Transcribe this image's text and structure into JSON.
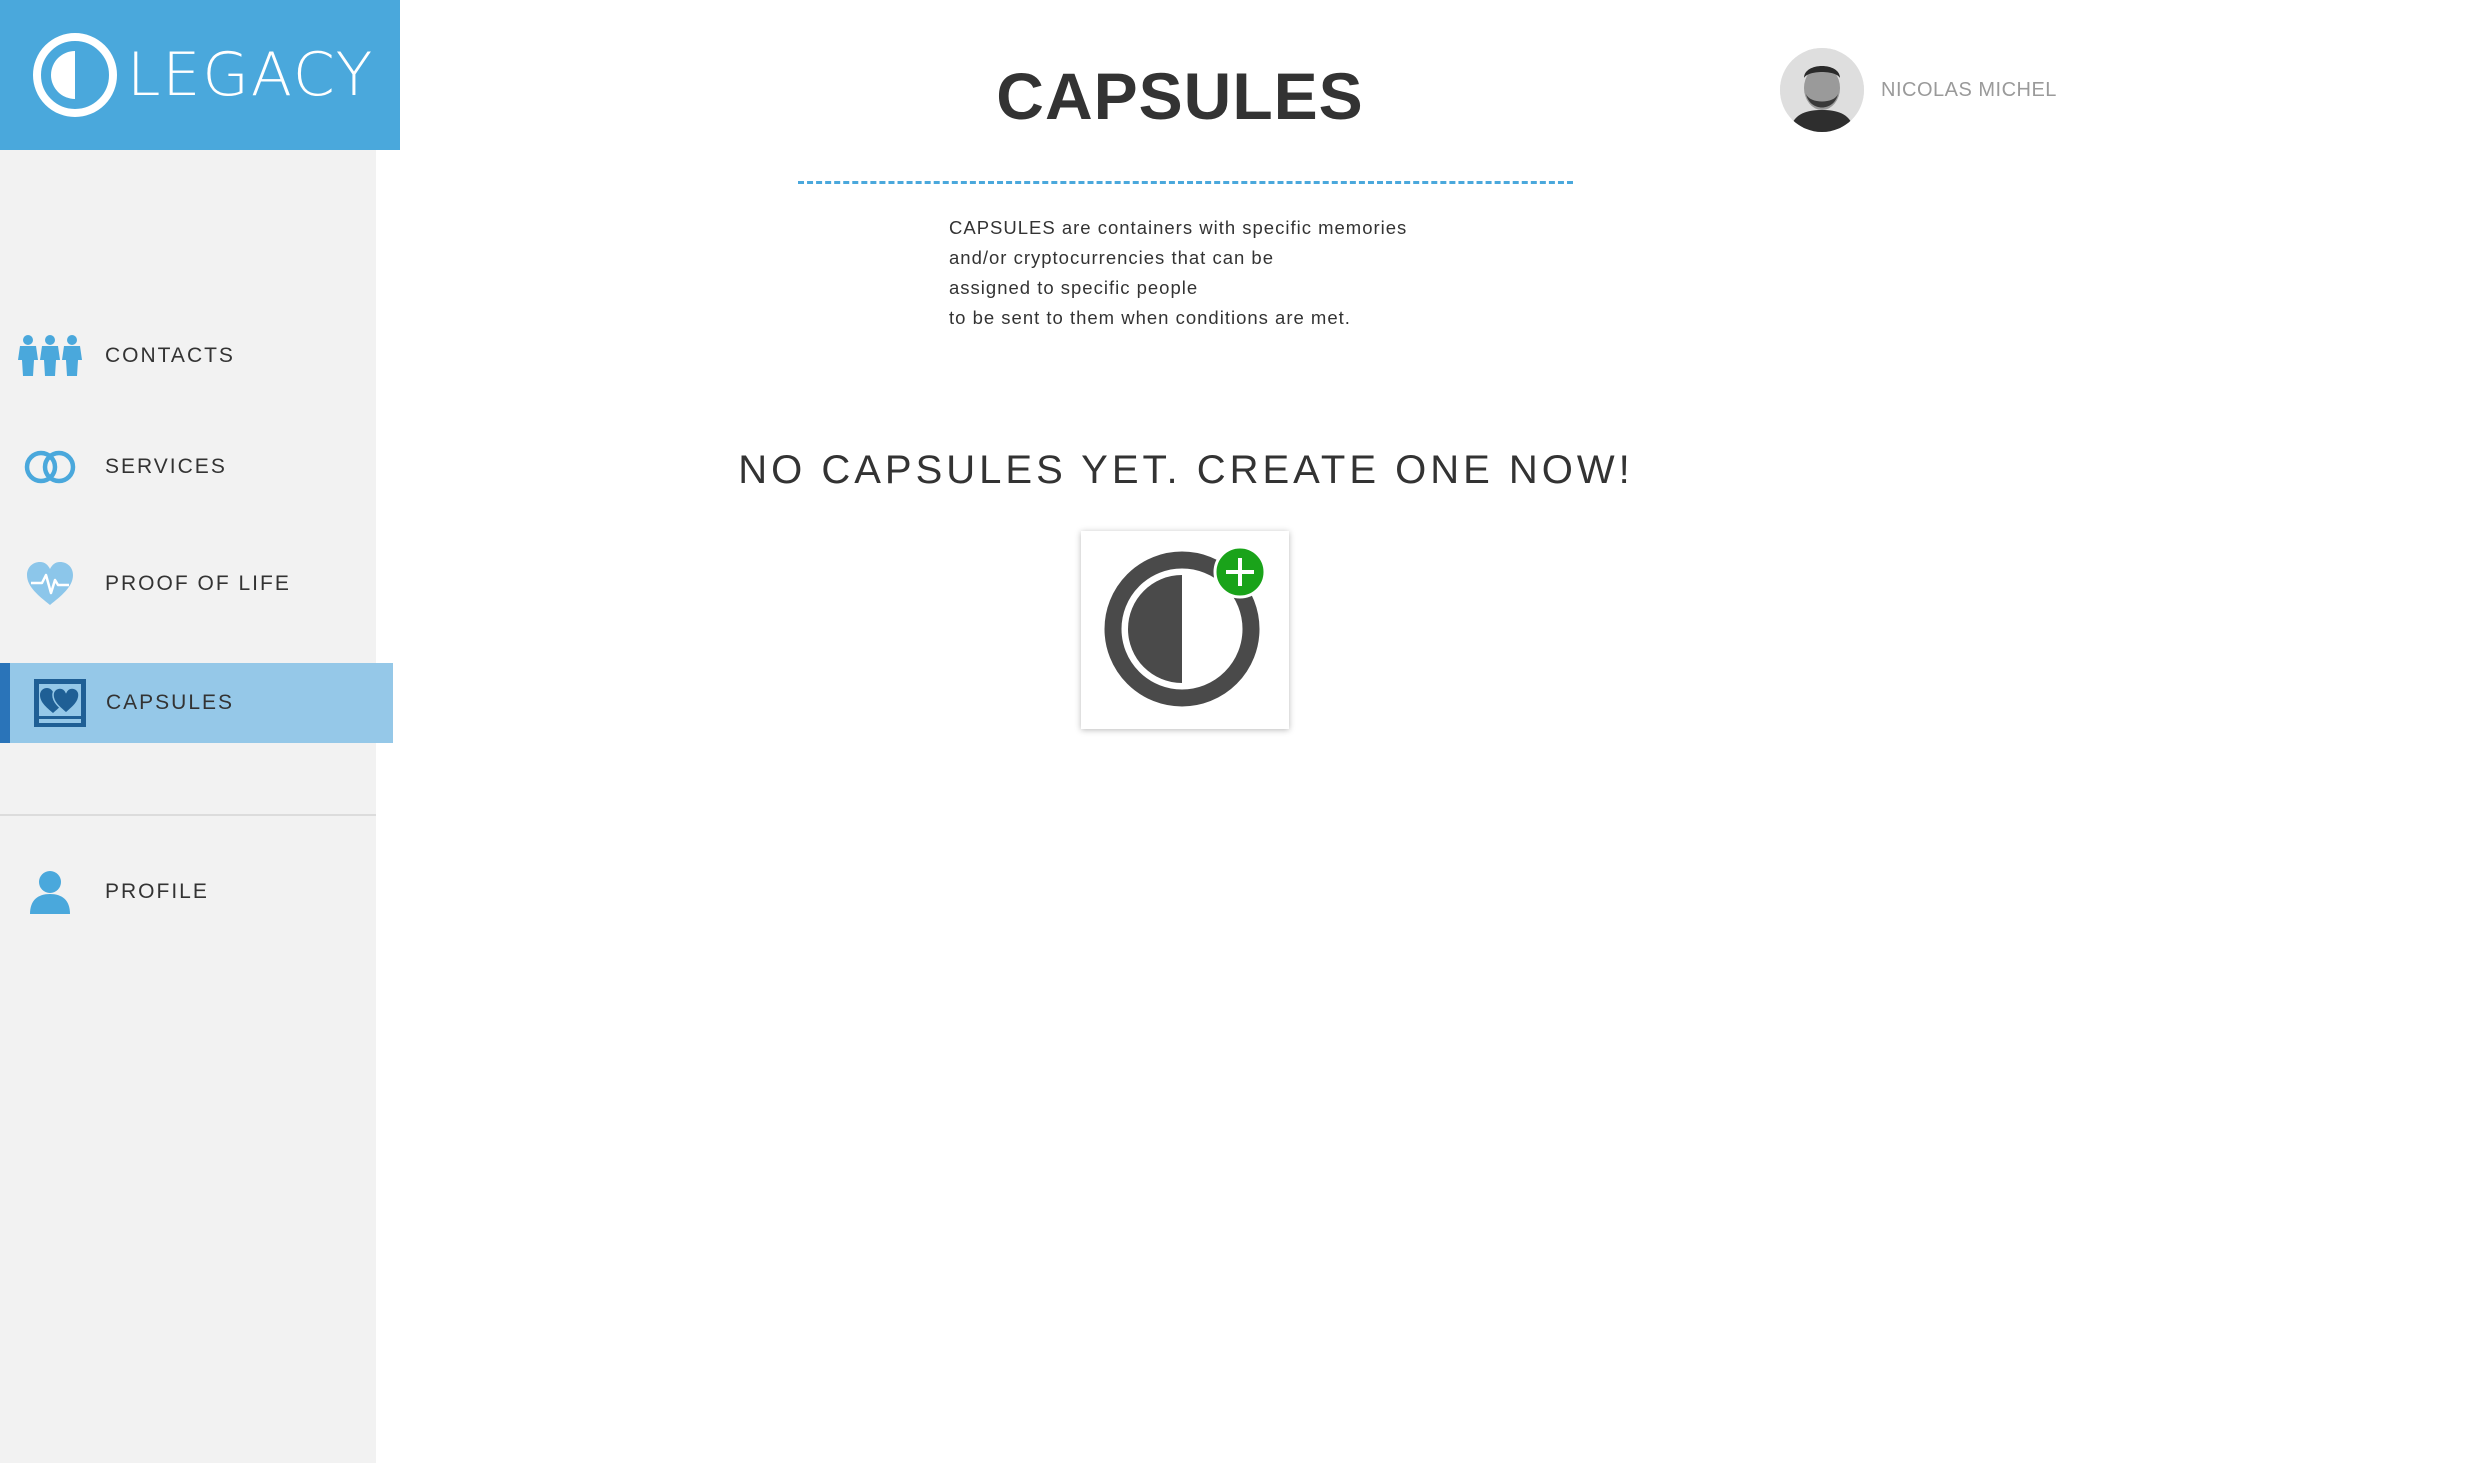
{
  "app": {
    "brand_name": "LEGACY"
  },
  "sidebar": {
    "items": [
      {
        "id": "contacts",
        "label": "CONTACTS",
        "icon": "contacts-icon",
        "active": false
      },
      {
        "id": "services",
        "label": "SERVICES",
        "icon": "linked-rings-icon",
        "active": false
      },
      {
        "id": "proof",
        "label": "PROOF OF LIFE",
        "icon": "heartbeat-icon",
        "active": false
      },
      {
        "id": "capsules",
        "label": "CAPSULES",
        "icon": "capsule-heart-icon",
        "active": true
      },
      {
        "id": "profile",
        "label": "PROFILE",
        "icon": "user-icon",
        "active": false
      }
    ]
  },
  "header": {
    "title": "CAPSULES",
    "user_name": "NICOLAS MICHEL"
  },
  "main": {
    "description_lines": [
      "CAPSULES are containers with specific memories",
      "and/or cryptocurrencies that can be",
      "assigned to specific people",
      "to be sent to them when conditions are met."
    ],
    "empty_message": "NO CAPSULES YET. CREATE ONE NOW!",
    "create_button_icon": "add-capsule-icon"
  },
  "colors": {
    "brand_blue": "#4aa8dc",
    "sidebar_bg": "#f2f2f2",
    "active_item_bg": "#95c8e8",
    "active_item_border": "#2a74b9",
    "add_badge_green": "#1aa31a",
    "capsule_gray": "#4a4a4a",
    "text_dark": "#333333",
    "text_muted": "#9a9a9a"
  }
}
